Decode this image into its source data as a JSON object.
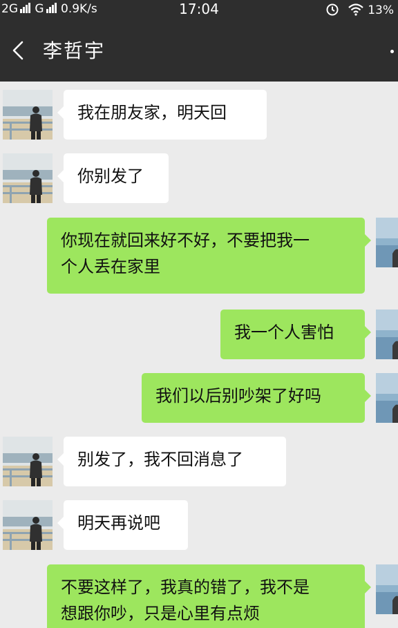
{
  "status_bar": {
    "network": "2G",
    "network2": "G",
    "speed": "0.9K/s",
    "time": "17:04",
    "battery": "13%"
  },
  "header": {
    "title": "李哲宇"
  },
  "messages": [
    {
      "side": "in",
      "text": "我在朋友家，明天回"
    },
    {
      "side": "in",
      "text": "你别发了"
    },
    {
      "side": "out",
      "text": "你现在就回来好不好，不要把我一\n个人丢在家里"
    },
    {
      "side": "out",
      "text": "我一个人害怕"
    },
    {
      "side": "out",
      "text": "我们以后别吵架了好吗"
    },
    {
      "side": "in",
      "text": "别发了，我不回消息了"
    },
    {
      "side": "in",
      "text": "明天再说吧"
    },
    {
      "side": "out",
      "text": "不要这样了，我真的错了，我不是\n想跟你吵，只是心里有点烦"
    }
  ]
}
